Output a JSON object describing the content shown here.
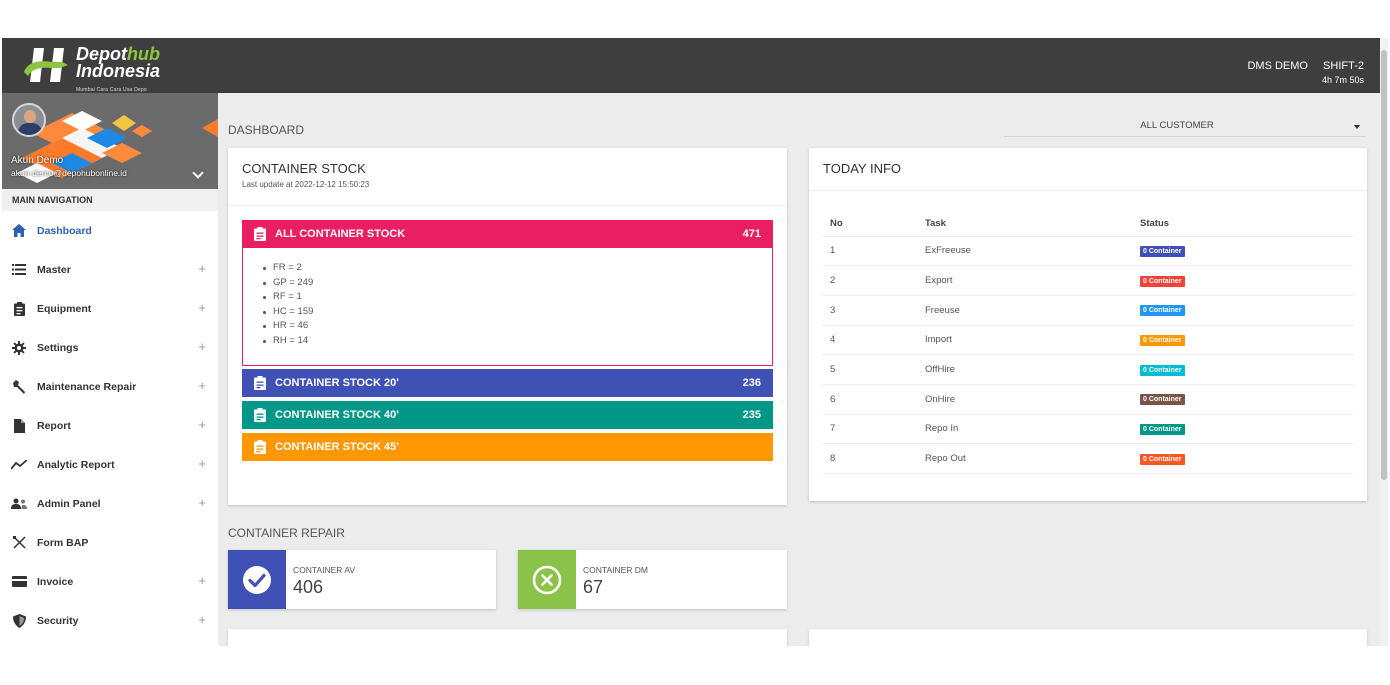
{
  "app": {
    "logo_line1_a": "Depot",
    "logo_line1_b": "hub",
    "logo_line2": "Indonesia",
    "logo_tagline": "Mumbai Cara Cara Usa Depo",
    "user_label": "DMS DEMO",
    "shift_label": "SHIFT-2",
    "shift_time": "4h 7m 50s",
    "brand_green": "#8cc63f",
    "topbar_color": "#3e3e3e"
  },
  "sidebar": {
    "profile_name": "Akun Demo",
    "profile_email": "akun-demo@depohubonline.id",
    "nav_header": "MAIN NAVIGATION",
    "items": [
      {
        "label": "Dashboard",
        "icon": "home-icon",
        "active": true,
        "expandable": false
      },
      {
        "label": "Master",
        "icon": "list-icon",
        "expandable": true
      },
      {
        "label": "Equipment",
        "icon": "clipboard-icon",
        "expandable": true
      },
      {
        "label": "Settings",
        "icon": "gear-icon",
        "expandable": true
      },
      {
        "label": "Maintenance Repair",
        "icon": "wrench-icon",
        "expandable": true
      },
      {
        "label": "Report",
        "icon": "document-icon",
        "expandable": true
      },
      {
        "label": "Analytic Report",
        "icon": "trending-line-icon",
        "expandable": true
      },
      {
        "label": "Admin Panel",
        "icon": "users-icon",
        "expandable": true
      },
      {
        "label": "Form BAP",
        "icon": "tools-cross-icon",
        "expandable": false
      },
      {
        "label": "Invoice",
        "icon": "credit-card-icon",
        "expandable": true
      },
      {
        "label": "Security",
        "icon": "shield-icon",
        "expandable": true
      }
    ],
    "plus_symbol": "+"
  },
  "main": {
    "dashboard_title": "DASHBOARD",
    "customer_select": "ALL CUSTOMER",
    "container_stock": {
      "title": "CONTAINER STOCK",
      "last_update": "Last update at 2022-12-12 15:50:23",
      "all": {
        "label": "ALL CONTAINER STOCK",
        "count": "471",
        "color": "#e91e63"
      },
      "breakdown": [
        "FR = 2",
        "GP = 249",
        "RF = 1",
        "HC = 159",
        "HR = 46",
        "RH = 14"
      ],
      "s20": {
        "label": "CONTAINER STOCK 20'",
        "count": "236",
        "color": "#3f51b5"
      },
      "s40": {
        "label": "CONTAINER STOCK 40'",
        "count": "235",
        "color": "#009688"
      },
      "s45": {
        "label": "CONTAINER STOCK 45'",
        "count": "",
        "color": "#ff9800"
      }
    },
    "today_info": {
      "title": "TODAY INFO",
      "headers": [
        "No",
        "Task",
        "Status"
      ],
      "rows": [
        {
          "no": "1",
          "task": "ExFreeuse",
          "status": "0 Container",
          "color": "#3f51b5"
        },
        {
          "no": "2",
          "task": "Export",
          "status": "0 Container",
          "color": "#f44336"
        },
        {
          "no": "3",
          "task": "Freeuse",
          "status": "0 Container",
          "color": "#2196f3"
        },
        {
          "no": "4",
          "task": "Import",
          "status": "0 Container",
          "color": "#ff9800"
        },
        {
          "no": "5",
          "task": "OffHire",
          "status": "0 Container",
          "color": "#00bcd4"
        },
        {
          "no": "6",
          "task": "OnHire",
          "status": "0 Container",
          "color": "#795548"
        },
        {
          "no": "7",
          "task": "Repo In",
          "status": "0 Container",
          "color": "#009688"
        },
        {
          "no": "8",
          "task": "Repo Out",
          "status": "0 Container",
          "color": "#ff5722"
        }
      ]
    },
    "container_repair": {
      "title": "CONTAINER REPAIR",
      "av": {
        "label": "CONTAINER AV",
        "value": "406",
        "color": "#3f51b5",
        "icon": "check-circle-icon"
      },
      "dm": {
        "label": "CONTAINER DM",
        "value": "67",
        "color": "#8bc34a",
        "icon": "x-circle-icon"
      }
    }
  }
}
